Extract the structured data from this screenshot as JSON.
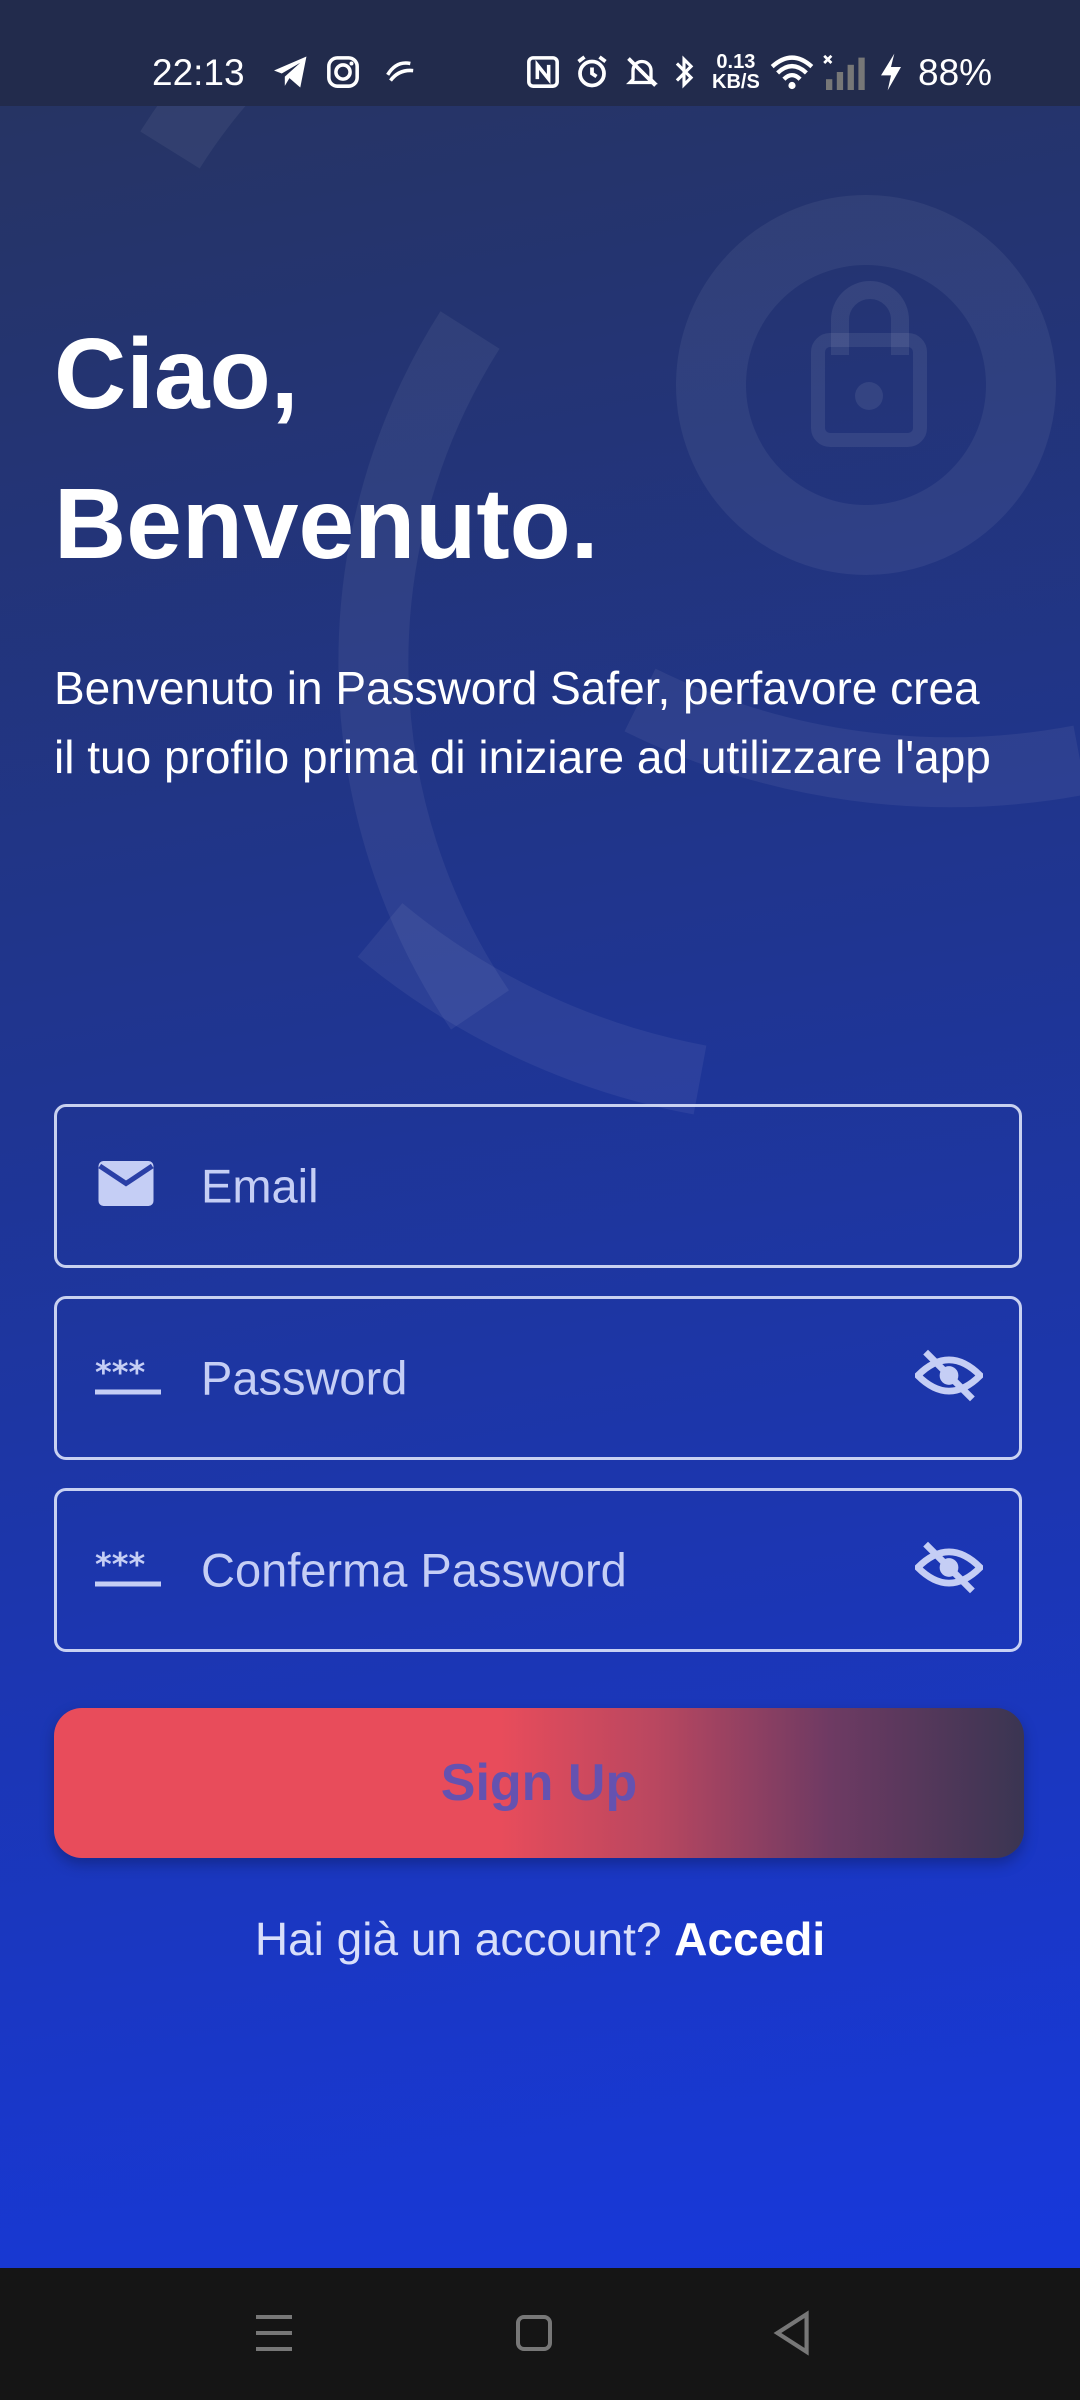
{
  "status_bar": {
    "time": "22:13",
    "net_speed_value": "0.13",
    "net_speed_unit": "KB/S",
    "battery": "88%",
    "icons": [
      "telegram-icon",
      "instagram-icon",
      "chat-icon",
      "nfc-icon",
      "alarm-icon",
      "mute-icon",
      "bluetooth-icon",
      "wifi-icon",
      "signal-icon",
      "charging-icon"
    ]
  },
  "greeting": {
    "line1": "Ciao,",
    "line2": "Benvenuto."
  },
  "intro_text": "Benvenuto in Password Safer, perfavore crea il tuo profilo prima di iniziare ad utilizzare l'app",
  "form": {
    "email_placeholder": "Email",
    "password_placeholder": "Password",
    "confirm_password_placeholder": "Conferma Password",
    "signup_label": "Sign Up"
  },
  "login_prompt": {
    "text": "Hai già un account?",
    "link": "Accedi"
  },
  "colors": {
    "button_start": "#e84c5b",
    "button_end": "#3a3552",
    "background_top": "#27345f",
    "background_bottom": "#1738dc"
  }
}
